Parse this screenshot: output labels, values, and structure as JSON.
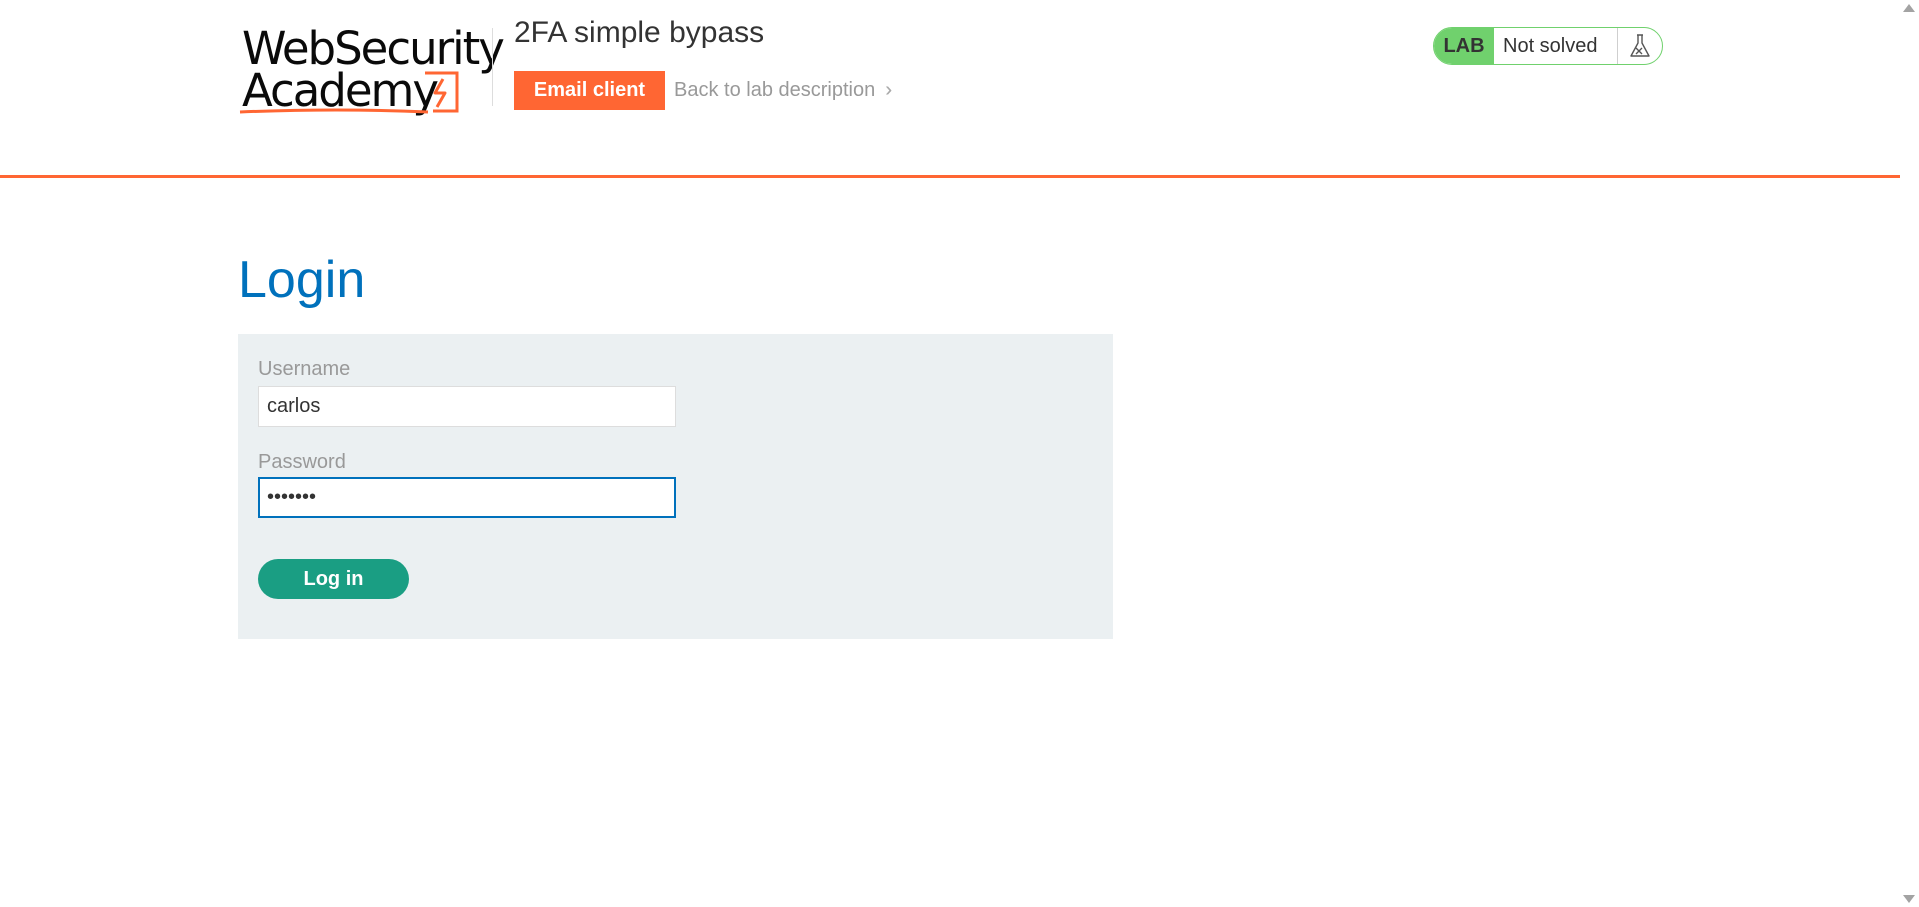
{
  "header": {
    "logo": {
      "line1": "WebSecurity",
      "line2": "Academy"
    },
    "lab_title": "2FA simple bypass",
    "email_client_label": "Email client",
    "back_link_label": "Back to lab description",
    "back_link_icon": "double-chevron-right-icon"
  },
  "lab_status": {
    "badge": "LAB",
    "state": "Not solved",
    "icon": "flask-icon",
    "color_unsolved": "#70d16d"
  },
  "login": {
    "title": "Login",
    "username_label": "Username",
    "username_value": "carlos",
    "password_label": "Password",
    "password_value": "•••••••",
    "submit_label": "Log in"
  },
  "colors": {
    "accent": "#ff6633",
    "title_blue": "#0071bc",
    "button_green": "#1a9e83",
    "panel_bg": "#ebf0f2"
  }
}
